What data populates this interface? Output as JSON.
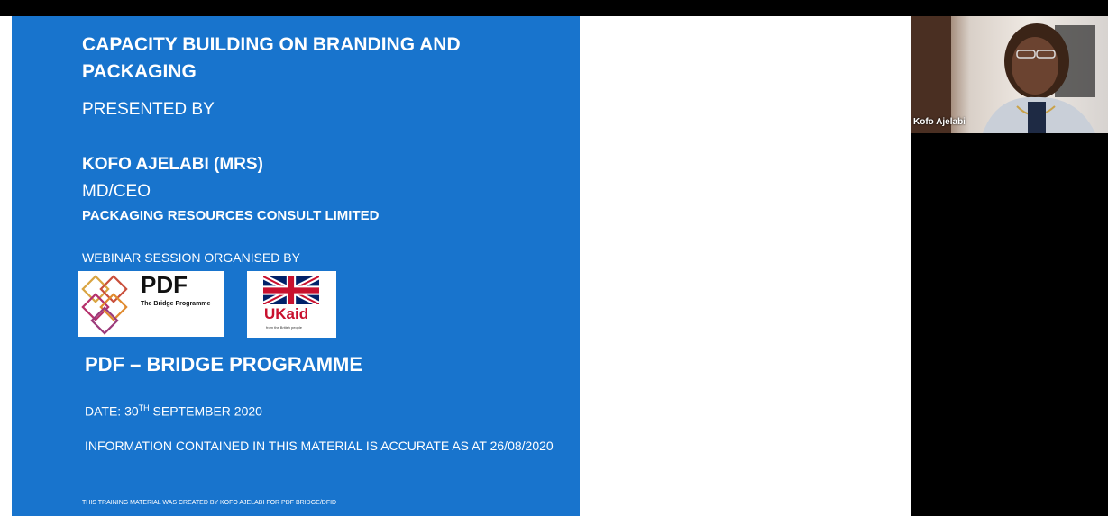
{
  "slide": {
    "title": "CAPACITY BUILDING ON BRANDING AND PACKAGING",
    "presented_by": "PRESENTED BY",
    "presenter_name": "KOFO AJELABI (MRS)",
    "presenter_role": "MD/CEO",
    "company": "PACKAGING RESOURCES CONSULT LIMITED",
    "organised_by": "WEBINAR SESSION ORGANISED BY",
    "logos": {
      "pdf_title": "PDF",
      "pdf_subtitle": "The Bridge Programme",
      "ukaid_text": "UKaid",
      "ukaid_subtitle": "from the British people"
    },
    "programme": "PDF – BRIDGE PROGRAMME",
    "date_prefix": "DATE: 30",
    "date_sup": "TH",
    "date_suffix": " SEPTEMBER 2020",
    "info": "INFORMATION CONTAINED IN THIS MATERIAL IS ACCURATE AS AT 26/08/2020",
    "footer": "THIS TRAINING MATERIAL WAS CREATED BY KOFO AJELABI FOR PDF BRIDGE/DFID"
  },
  "video": {
    "participant_name": "Kofo Ajelabi"
  },
  "colors": {
    "slide_bg": "#1874cd",
    "ukaid_red": "#c8102e",
    "flag_blue": "#012169"
  }
}
